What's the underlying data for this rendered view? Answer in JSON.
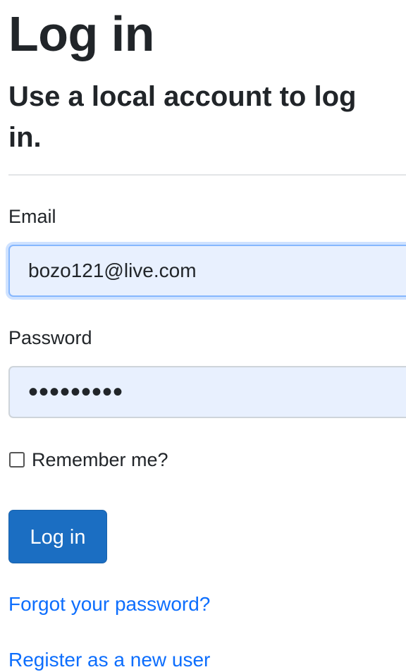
{
  "page": {
    "title": "Log in",
    "subtitle_line1": "Use a local account to log",
    "subtitle_line2": "in."
  },
  "form": {
    "email": {
      "label": "Email",
      "value": "bozo121@live.com"
    },
    "password": {
      "label": "Password",
      "masked_value": "•••••••••"
    },
    "remember_me": {
      "label": "Remember me?",
      "checked": false
    },
    "submit_label": "Log in"
  },
  "links": {
    "forgot_password": "Forgot your password?",
    "register": "Register as a new user"
  },
  "colors": {
    "primary_button": "#1b6ec2",
    "link": "#0d6efd",
    "autofill_background": "#e8f0fe",
    "focus_border": "#86b7fe"
  }
}
